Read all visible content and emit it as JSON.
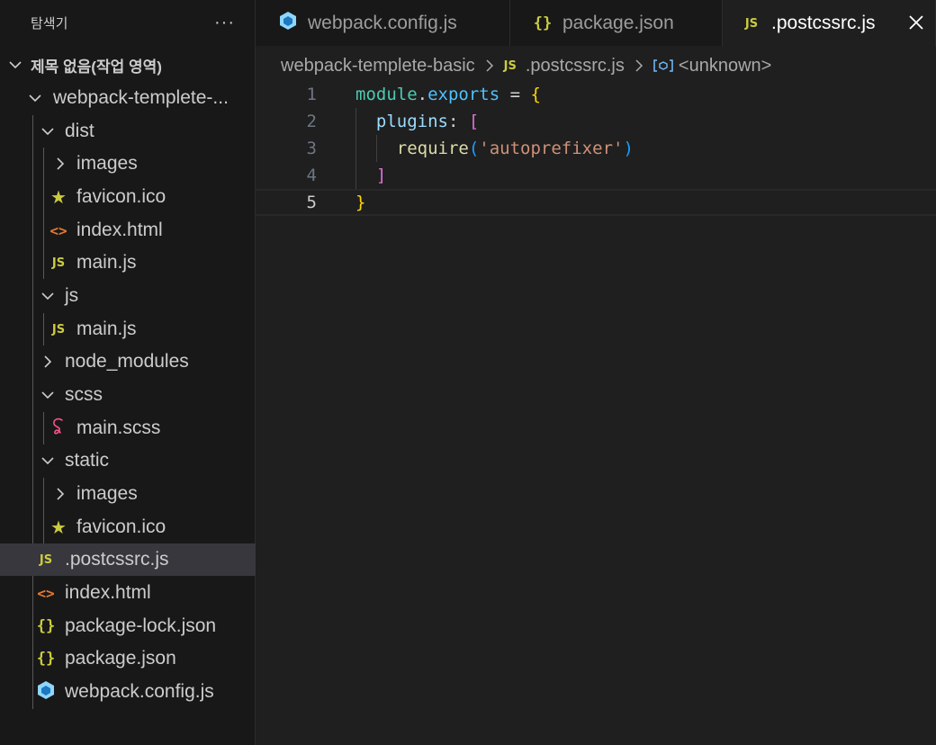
{
  "sidebar": {
    "title": "탐색기",
    "more": "···",
    "workspace": "제목 없음(작업 영역)",
    "items": [
      {
        "label": "webpack-templete-...",
        "kind": "folder-open"
      },
      {
        "label": "dist",
        "kind": "folder-open"
      },
      {
        "label": "images",
        "kind": "folder-closed"
      },
      {
        "label": "favicon.ico",
        "kind": "star",
        "icon": "☆"
      },
      {
        "label": "index.html",
        "kind": "html",
        "icon": "<>"
      },
      {
        "label": "main.js",
        "kind": "js",
        "icon": "JS"
      },
      {
        "label": "js",
        "kind": "folder-open"
      },
      {
        "label": "main.js",
        "kind": "js",
        "icon": "JS"
      },
      {
        "label": "node_modules",
        "kind": "folder-closed"
      },
      {
        "label": "scss",
        "kind": "folder-open"
      },
      {
        "label": "main.scss",
        "kind": "scss"
      },
      {
        "label": "static",
        "kind": "folder-open"
      },
      {
        "label": "images",
        "kind": "folder-closed"
      },
      {
        "label": "favicon.ico",
        "kind": "star",
        "icon": "☆"
      },
      {
        "label": ".postcssrc.js",
        "kind": "js",
        "icon": "JS",
        "selected": true
      },
      {
        "label": "index.html",
        "kind": "html",
        "icon": "<>"
      },
      {
        "label": "package-lock.json",
        "kind": "json",
        "icon": "{}"
      },
      {
        "label": "package.json",
        "kind": "json",
        "icon": "{}"
      },
      {
        "label": "webpack.config.js",
        "kind": "webpack"
      }
    ]
  },
  "tabs": [
    {
      "label": "webpack.config.js",
      "icon": "webpack-icon",
      "active": false
    },
    {
      "label": "package.json",
      "icon": "{}",
      "active": false
    },
    {
      "label": ".postcssrc.js",
      "icon": "JS",
      "active": true
    }
  ],
  "breadcrumb": {
    "folder": "webpack-templete-basic",
    "file_icon": "JS",
    "file": ".postcssrc.js",
    "symbol": "<unknown>"
  },
  "editor": {
    "current_line": 5,
    "lines": [
      {
        "num": "1",
        "tokens": [
          {
            "t": "module",
            "c": "kw"
          },
          {
            "t": ".",
            "c": "plain"
          },
          {
            "t": "exports",
            "c": "prop"
          },
          {
            "t": " = ",
            "c": "plain"
          },
          {
            "t": "{",
            "c": "brace"
          }
        ]
      },
      {
        "num": "2",
        "tokens": [
          {
            "t": "  plugins",
            "c": "key"
          },
          {
            "t": ": ",
            "c": "plain"
          },
          {
            "t": "[",
            "c": "bracket"
          }
        ]
      },
      {
        "num": "3",
        "tokens": [
          {
            "t": "    require",
            "c": "fn"
          },
          {
            "t": "(",
            "c": "paren"
          },
          {
            "t": "'autoprefixer'",
            "c": "str"
          },
          {
            "t": ")",
            "c": "paren"
          }
        ]
      },
      {
        "num": "4",
        "tokens": [
          {
            "t": "  ]",
            "c": "bracket"
          }
        ]
      },
      {
        "num": "5",
        "tokens": [
          {
            "t": "}",
            "c": "brace"
          }
        ]
      }
    ]
  }
}
